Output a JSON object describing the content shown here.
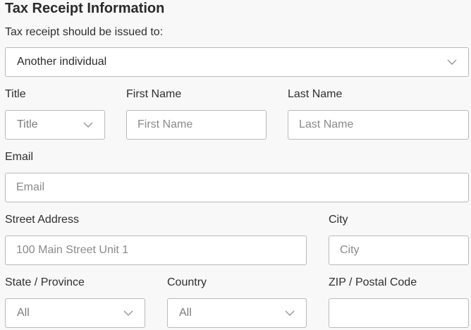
{
  "heading": "Tax Receipt Information",
  "issued_to": {
    "label": "Tax receipt should be issued to:",
    "value": "Another individual"
  },
  "title": {
    "label": "Title",
    "value": "Title"
  },
  "first_name": {
    "label": "First Name",
    "placeholder": "First Name"
  },
  "last_name": {
    "label": "Last Name",
    "placeholder": "Last Name"
  },
  "email": {
    "label": "Email",
    "placeholder": "Email"
  },
  "street": {
    "label": "Street Address",
    "placeholder": "100 Main Street Unit 1"
  },
  "city": {
    "label": "City",
    "placeholder": "City"
  },
  "state": {
    "label": "State / Province",
    "value": "All"
  },
  "country": {
    "label": "Country",
    "value": "All"
  },
  "zip": {
    "label": "ZIP / Postal Code",
    "placeholder": ""
  },
  "icons": {
    "dropdown": "chevron-down-icon"
  },
  "colors": {
    "border": "#b9b9b9",
    "background": "#f8f8f8",
    "placeholder": "#8a8a8a"
  }
}
